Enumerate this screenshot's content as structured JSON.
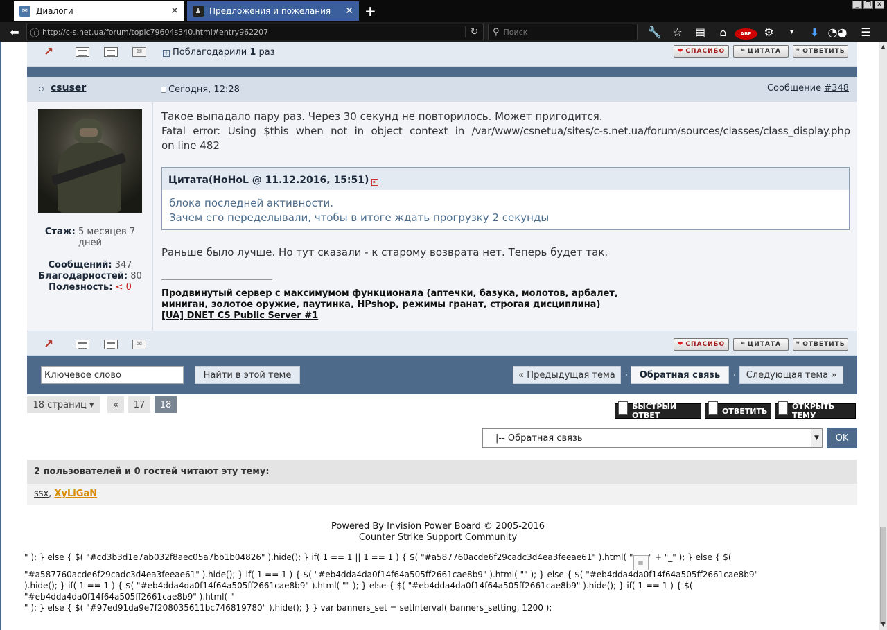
{
  "browser": {
    "tabs": [
      {
        "title": "Диалоги",
        "active": false
      },
      {
        "title": "Предложения и пожелания",
        "active": true
      }
    ],
    "url": "http://c-s.net.ua/forum/topic79604s340.html#entry962207",
    "search_placeholder": "Поиск",
    "icons": [
      "back-icon",
      "info-icon",
      "reload-icon",
      "search-icon",
      "wrench-icon",
      "star-icon",
      "reading-list-icon",
      "home-icon",
      "adblock-icon",
      "plugin-icon",
      "dropdown-icon",
      "download-icon",
      "mask-icon",
      "menu-icon"
    ]
  },
  "top_post_bar": {
    "thanked_prefix": "Поблагодарили",
    "thanked_count": "1",
    "thanked_suffix": "раз"
  },
  "post": {
    "author": "csuser",
    "date": "Сегодня, 12:28",
    "message_label": "Сообщение",
    "message_number": "#348",
    "stats": {
      "tenure_label": "Стаж:",
      "tenure_value": "5 месяцев 7",
      "tenure_value2": "дней",
      "posts_label": "Сообщений:",
      "posts_value": "347",
      "thanks_label": "Благодарностей:",
      "thanks_value": "80",
      "usefulness_label": "Полезность:",
      "usefulness_value": "< 0"
    },
    "body_line1": "Такое выпадало пару раз. Через 30 секунд не повторилось. Может пригодится.",
    "body_line2": "Fatal error: Using $this when not in object context in /var/www/csnetua/sites/c-s.net.ua/forum/sources/classes/class_display.php",
    "body_line3": "on line 482",
    "quote_header": "Цитата(HoHoL @ 11.12.2016, 15:51)",
    "quote_line1": "блока последней активности.",
    "quote_line2": "Зачем его переделывали, чтобы в итоге ждать прогрузку 2 секунды",
    "body_after": "Раньше было лучше. Но тут сказали - к старому возврата нет. Теперь будет так.",
    "signature_line1": "Продвинутый сервер с максимумом функционала (аптечки, базука, молотов, арбалет,",
    "signature_line2": "миниган, золотое оружие, паутинка, HPshop, режимы гранат, строгая дисциплина)",
    "signature_link": "[UA] DNET CS Public Server #1"
  },
  "post_buttons": {
    "thanks": "СПАСИБО",
    "quote": "ЦИТАТА",
    "reply": "ОТВЕТИТЬ"
  },
  "search_bar": {
    "keyword_value": "Ключевое слово",
    "find_button": "Найти в этой теме",
    "prev_topic": "« Предыдущая тема",
    "current_forum": "Обратная связь",
    "next_topic": "Следующая тема »"
  },
  "pagination": {
    "pages_label": "18 страниц ▾",
    "first": "«",
    "prev_page": "17",
    "current_page": "18"
  },
  "action_buttons": {
    "fast_reply": "БЫСТРЫЙ ОТВЕТ",
    "reply": "ОТВЕТИТЬ",
    "new_topic": "ОТКРЫТЬ ТЕМУ"
  },
  "forum_jump": {
    "selected": "|-- Обратная связь",
    "ok": "OK"
  },
  "readers": {
    "title": "2 пользователей и 0 гостей читают эту тему:",
    "user1": "ssx",
    "separator": ",",
    "user2": "XyLiGaN"
  },
  "footer": {
    "line1": "Powered By Invision Power Board  © 2005-2016",
    "line2": "Counter Strike Support Community"
  },
  "js_dump": {
    "line1a": "\" ); } else { $( \"#cd3b3d1e7ab032f8aec05a7bb1b04826\" ).hide(); } if( 1 == 1 || 1 == 1 ) { $( \"#a587760acde6f29cadc3d4ea3feeae61\" ).html( \"",
    "line1b": "\" + \"_\" ); } else { $(",
    "line2": "\"#a587760acde6f29cadc3d4ea3feeae61\" ).hide(); } if( 1 == 1 ) { $( \"#eb4dda4da0f14f64a505ff2661cae8b9\" ).html( \"\" ); } else { $( \"#eb4dda4da0f14f64a505ff2661cae8b9\"",
    "line3": ").hide(); } if( 1 == 1 ) { $( \"#eb4dda4da0f14f64a505ff2661cae8b9\" ).html( \"\" ); } else { $( \"#eb4dda4da0f14f64a505ff2661cae8b9\" ).hide(); } if( 1 == 1 ) { $(",
    "line4": "\"#eb4dda4da0f14f64a505ff2661cae8b9\" ).html( \"",
    "line5": "\" ); } else { $( \"#97ed91da9e7f208035611bc746819780\" ).hide(); } } var banners_set = setInterval( banners_setting, 1200 );"
  }
}
